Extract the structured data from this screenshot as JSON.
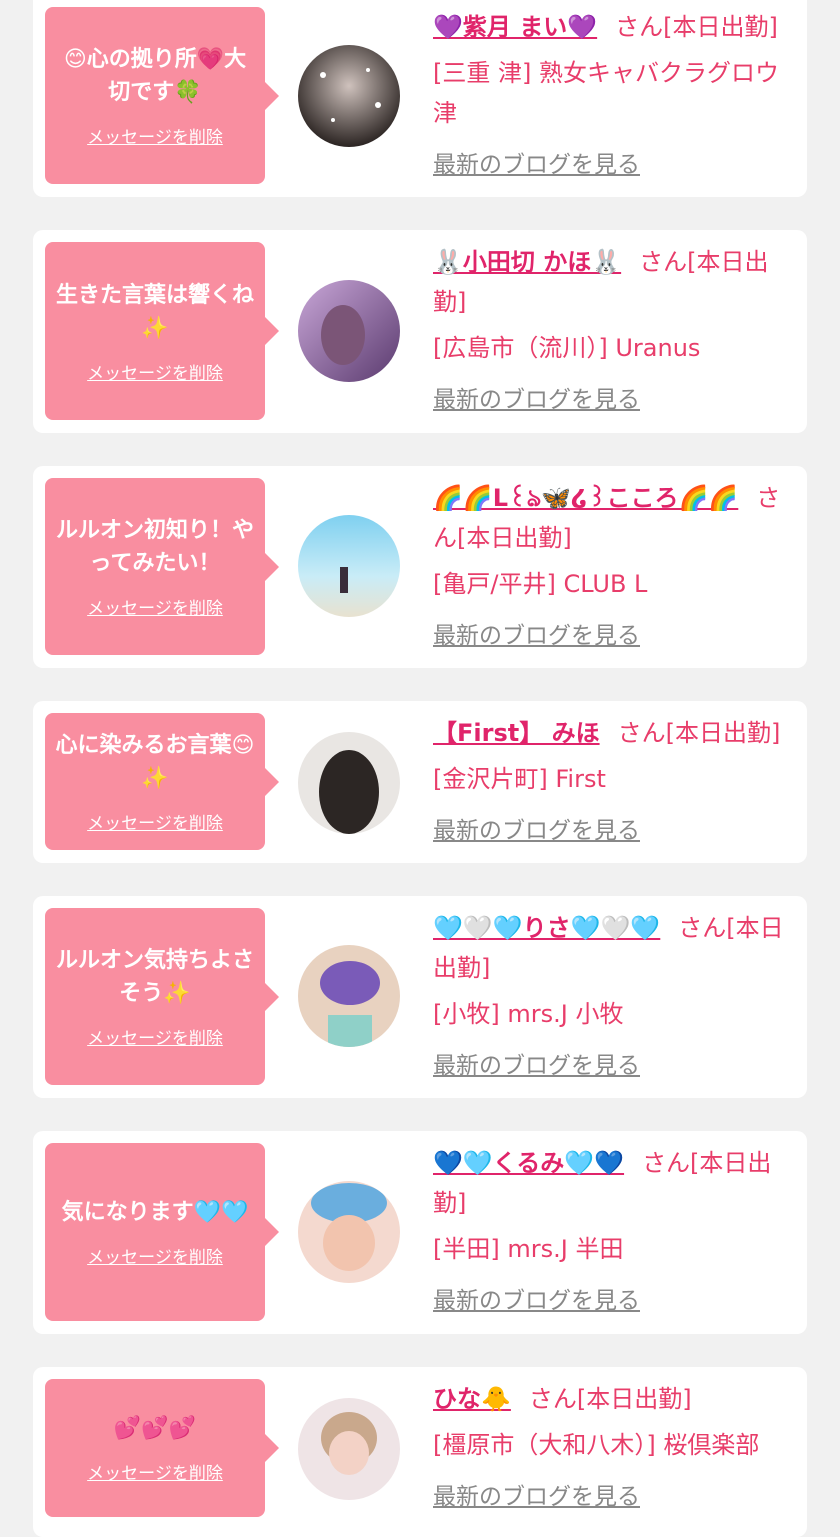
{
  "colors": {
    "page_bg": "#f1f1f1",
    "card_bg": "#ffffff",
    "bubble_bg": "#f98ea0",
    "accent_text": "#e83d6a",
    "name_text": "#e0246a",
    "link_gray": "#888888"
  },
  "labels": {
    "delete_message": "メッセージを削除",
    "san_status": "さん[本日出勤]",
    "view_blog": "最新のブログを見る"
  },
  "messages": [
    {
      "message": "😊心の拠り所💗大切です🍀",
      "cast_name": "💜紫月 まい💜",
      "shop": "[三重 津] 熟女キャバクラグロウ津"
    },
    {
      "message": "生きた言葉は響くね✨",
      "cast_name": "🐰小田切 かほ🐰",
      "shop": "[広島市（流川）] Uranus"
    },
    {
      "message": "ルルオン初知り！やってみたい！",
      "cast_name": "🌈🌈L꒰ঌ🦋໒꒱こころ🌈🌈",
      "shop": "[亀戸/平井] CLUB L"
    },
    {
      "message": "心に染みるお言葉😊✨",
      "cast_name": "【First】 みほ",
      "shop": "[金沢片町] First"
    },
    {
      "message": "ルルオン気持ちよさそう✨",
      "cast_name": "🩵🤍🩵りさ🩵🤍🩵",
      "shop": "[小牧] mrs.J 小牧"
    },
    {
      "message": "気になります🩵🩵",
      "cast_name": "💙🩵くるみ🩵💙",
      "shop": "[半田] mrs.J 半田"
    },
    {
      "message": "💕💕💕",
      "cast_name": "ひな🐥",
      "shop": "[橿原市（大和八木）] 桜倶楽部"
    }
  ]
}
